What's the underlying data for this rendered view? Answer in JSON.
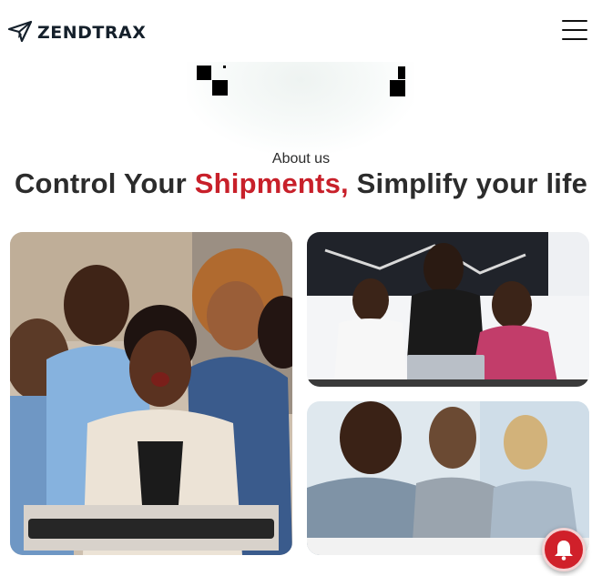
{
  "header": {
    "brand": "ZENDTRAX",
    "logo_icon": "paper-plane-icon",
    "menu_icon": "hamburger-menu-icon"
  },
  "about": {
    "eyebrow": "About us",
    "headline_part1": "Control Your ",
    "headline_accent": "Shipments,",
    "headline_part2": " Simplify your life"
  },
  "photos": [
    {
      "name": "excited-team-at-computer-photo"
    },
    {
      "name": "women-looking-at-laptop-photo"
    },
    {
      "name": "business-meeting-photo"
    }
  ],
  "notification": {
    "icon": "bell-icon"
  },
  "colors": {
    "accent": "#c8202a",
    "text": "#2c2c2c",
    "brand_dark": "#15202b"
  }
}
